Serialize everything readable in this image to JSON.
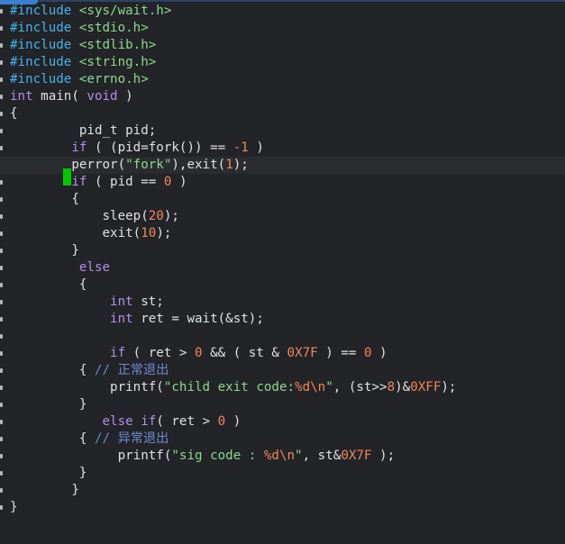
{
  "editor": {
    "theme": {
      "background": "#222428",
      "current_line": "#2b2c30",
      "cursor": "#00c800",
      "accent_tab": "#3b7fd0"
    },
    "cursor_line": 9,
    "lines": [
      [
        {
          "t": "pp",
          "v": "#include"
        },
        {
          "t": "tx",
          "v": " "
        },
        {
          "t": "hd",
          "v": "<sys/wait.h>"
        }
      ],
      [
        {
          "t": "pp",
          "v": "#include"
        },
        {
          "t": "tx",
          "v": " "
        },
        {
          "t": "hd",
          "v": "<stdio.h>"
        }
      ],
      [
        {
          "t": "pp",
          "v": "#include"
        },
        {
          "t": "tx",
          "v": " "
        },
        {
          "t": "hd",
          "v": "<stdlib.h>"
        }
      ],
      [
        {
          "t": "pp",
          "v": "#include"
        },
        {
          "t": "tx",
          "v": " "
        },
        {
          "t": "hd",
          "v": "<string.h>"
        }
      ],
      [
        {
          "t": "pp",
          "v": "#include"
        },
        {
          "t": "tx",
          "v": " "
        },
        {
          "t": "hd",
          "v": "<errno.h>"
        }
      ],
      [
        {
          "t": "kw",
          "v": "int"
        },
        {
          "t": "tx",
          "v": " main( "
        },
        {
          "t": "kw",
          "v": "void"
        },
        {
          "t": "tx",
          "v": " )"
        }
      ],
      [
        {
          "t": "tx",
          "v": "{"
        }
      ],
      [
        {
          "t": "tx",
          "v": "         pid_t pid;"
        }
      ],
      [
        {
          "t": "tx",
          "v": "        "
        },
        {
          "t": "kw",
          "v": "if"
        },
        {
          "t": "tx",
          "v": " ( (pid=fork()) == "
        },
        {
          "t": "nm",
          "v": "-1"
        },
        {
          "t": "tx",
          "v": " )"
        }
      ],
      [
        {
          "t": "tx",
          "v": "        perror("
        },
        {
          "t": "st",
          "v": "\"fork\""
        },
        {
          "t": "tx",
          "v": "),exit("
        },
        {
          "t": "nm",
          "v": "1"
        },
        {
          "t": "tx",
          "v": ");"
        }
      ],
      [
        {
          "t": "tx",
          "v": "        "
        },
        {
          "t": "kw",
          "v": "if"
        },
        {
          "t": "tx",
          "v": " ( pid == "
        },
        {
          "t": "nm",
          "v": "0"
        },
        {
          "t": "tx",
          "v": " )"
        }
      ],
      [
        {
          "t": "tx",
          "v": "        {"
        }
      ],
      [
        {
          "t": "tx",
          "v": "            sleep("
        },
        {
          "t": "nm",
          "v": "20"
        },
        {
          "t": "tx",
          "v": ");"
        }
      ],
      [
        {
          "t": "tx",
          "v": "            exit("
        },
        {
          "t": "nm",
          "v": "10"
        },
        {
          "t": "tx",
          "v": ");"
        }
      ],
      [
        {
          "t": "tx",
          "v": "        }"
        }
      ],
      [
        {
          "t": "tx",
          "v": "         "
        },
        {
          "t": "kw",
          "v": "else"
        }
      ],
      [
        {
          "t": "tx",
          "v": "         {"
        }
      ],
      [
        {
          "t": "tx",
          "v": "             "
        },
        {
          "t": "kw",
          "v": "int"
        },
        {
          "t": "tx",
          "v": " st;"
        }
      ],
      [
        {
          "t": "tx",
          "v": "             "
        },
        {
          "t": "kw",
          "v": "int"
        },
        {
          "t": "tx",
          "v": " ret = wait(&st);"
        }
      ],
      [
        {
          "t": "tx",
          "v": ""
        }
      ],
      [
        {
          "t": "tx",
          "v": "             "
        },
        {
          "t": "kw",
          "v": "if"
        },
        {
          "t": "tx",
          "v": " ( ret > "
        },
        {
          "t": "nm",
          "v": "0"
        },
        {
          "t": "tx",
          "v": " && ( st & "
        },
        {
          "t": "nm",
          "v": "0X7F"
        },
        {
          "t": "tx",
          "v": " ) == "
        },
        {
          "t": "nm",
          "v": "0"
        },
        {
          "t": "tx",
          "v": " )"
        }
      ],
      [
        {
          "t": "tx",
          "v": "         { "
        },
        {
          "t": "cm",
          "v": "// 正常退出"
        }
      ],
      [
        {
          "t": "tx",
          "v": "             printf("
        },
        {
          "t": "st",
          "v": "\"child exit code:"
        },
        {
          "t": "nm",
          "v": "%d\\n"
        },
        {
          "t": "st",
          "v": "\""
        },
        {
          "t": "tx",
          "v": ", (st>>"
        },
        {
          "t": "nm",
          "v": "8"
        },
        {
          "t": "tx",
          "v": ")&"
        },
        {
          "t": "nm",
          "v": "0XFF"
        },
        {
          "t": "tx",
          "v": ");"
        }
      ],
      [
        {
          "t": "tx",
          "v": "         }"
        }
      ],
      [
        {
          "t": "tx",
          "v": "            "
        },
        {
          "t": "kw",
          "v": "else"
        },
        {
          "t": "tx",
          "v": " "
        },
        {
          "t": "kw",
          "v": "if"
        },
        {
          "t": "tx",
          "v": "( ret > "
        },
        {
          "t": "nm",
          "v": "0"
        },
        {
          "t": "tx",
          "v": " )"
        }
      ],
      [
        {
          "t": "tx",
          "v": "         { "
        },
        {
          "t": "cm",
          "v": "// 异常退出"
        }
      ],
      [
        {
          "t": "tx",
          "v": "              printf("
        },
        {
          "t": "st",
          "v": "\"sig code : "
        },
        {
          "t": "nm",
          "v": "%d\\n"
        },
        {
          "t": "st",
          "v": "\""
        },
        {
          "t": "tx",
          "v": ", st&"
        },
        {
          "t": "nm",
          "v": "0X7F"
        },
        {
          "t": "tx",
          "v": " );"
        }
      ],
      [
        {
          "t": "tx",
          "v": "         }"
        }
      ],
      [
        {
          "t": "tx",
          "v": "        }"
        }
      ],
      [
        {
          "t": "tx",
          "v": "}"
        }
      ]
    ]
  }
}
